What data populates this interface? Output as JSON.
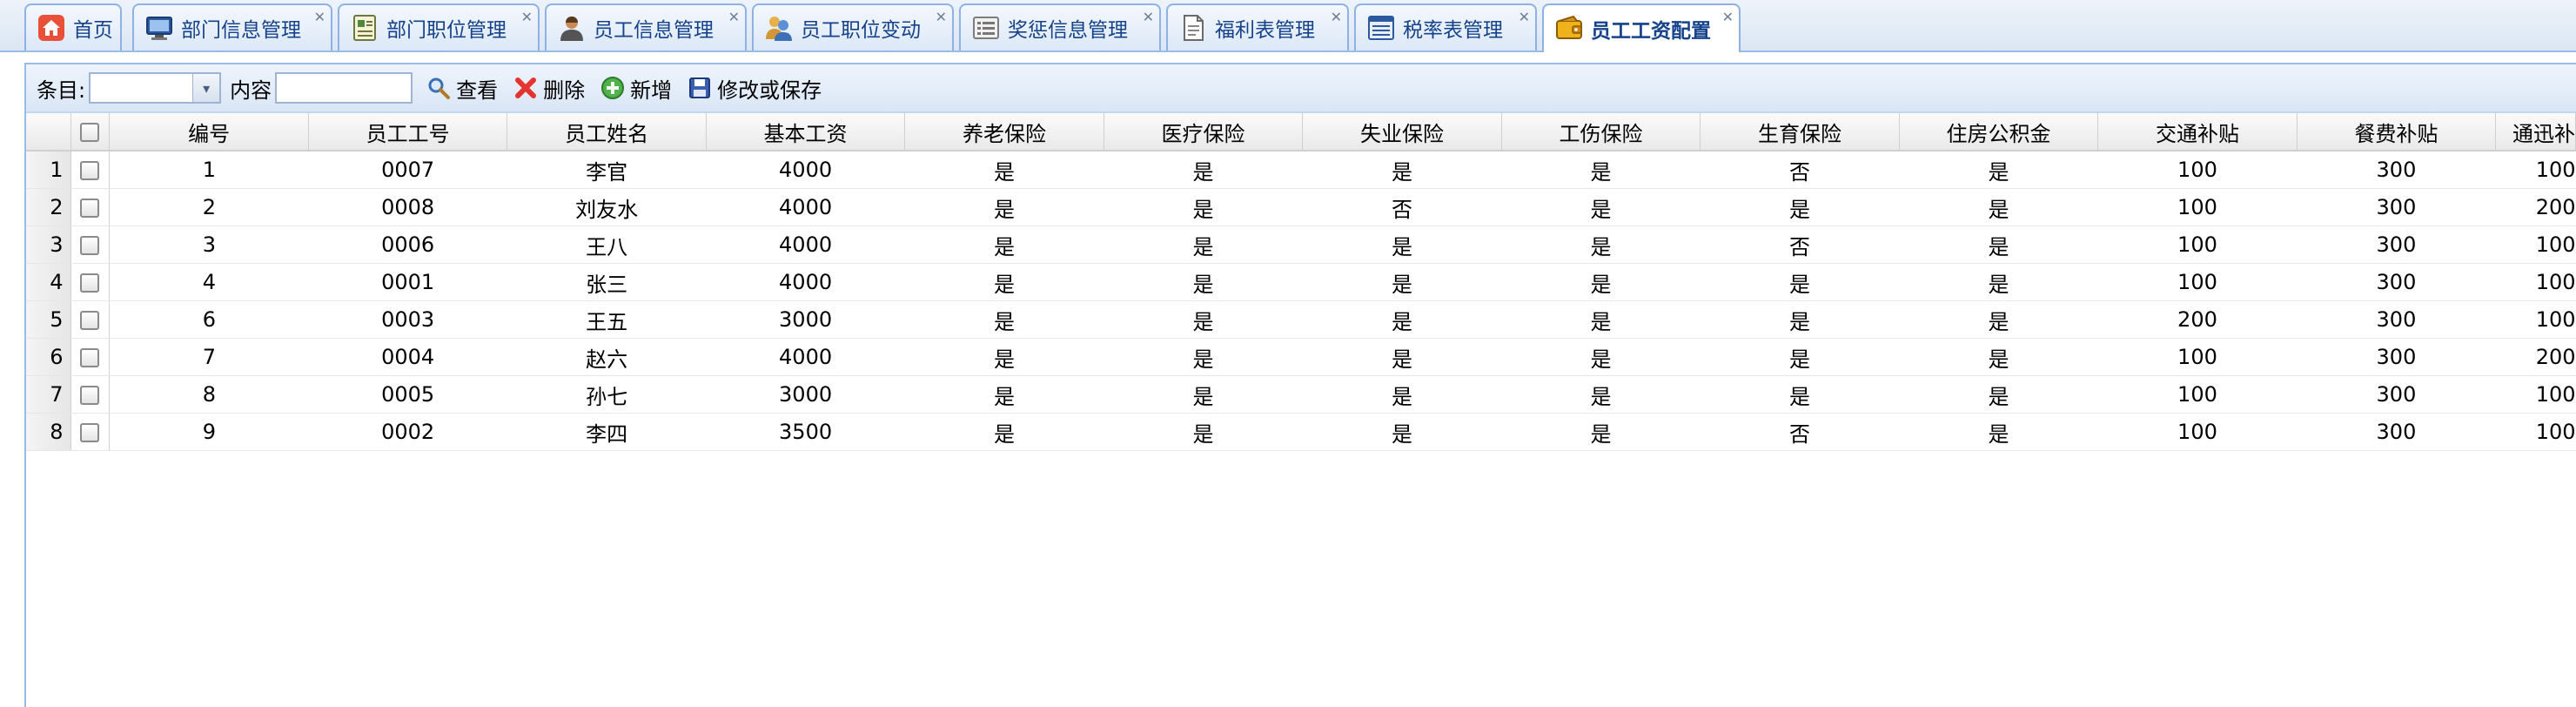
{
  "tabs": [
    {
      "label": "首页",
      "icon": "home-icon",
      "closable": false
    },
    {
      "label": "部门信息管理",
      "icon": "monitor-icon",
      "closable": true
    },
    {
      "label": "部门职位管理",
      "icon": "id-card-icon",
      "closable": true
    },
    {
      "label": "员工信息管理",
      "icon": "user-icon",
      "closable": true
    },
    {
      "label": "员工职位变动",
      "icon": "users-icon",
      "closable": true
    },
    {
      "label": "奖惩信息管理",
      "icon": "list-icon",
      "closable": true
    },
    {
      "label": "福利表管理",
      "icon": "document-icon",
      "closable": true
    },
    {
      "label": "税率表管理",
      "icon": "table-icon",
      "closable": true
    },
    {
      "label": "员工工资配置",
      "icon": "wallet-icon",
      "closable": true,
      "active": true
    }
  ],
  "toolbar": {
    "item_label": "条目:",
    "content_label": "内容",
    "view_label": "查看",
    "delete_label": "删除",
    "add_label": "新增",
    "save_label": "修改或保存"
  },
  "grid": {
    "columns": [
      "编号",
      "员工工号",
      "员工姓名",
      "基本工资",
      "养老保险",
      "医疗保险",
      "失业保险",
      "工伤保险",
      "生育保险",
      "住房公积金",
      "交通补贴",
      "餐费补贴",
      "通迅补"
    ],
    "rows": [
      {
        "rownum": "1",
        "cells": [
          "1",
          "0007",
          "李官",
          "4000",
          "是",
          "是",
          "是",
          "是",
          "否",
          "是",
          "100",
          "300",
          "100"
        ]
      },
      {
        "rownum": "2",
        "cells": [
          "2",
          "0008",
          "刘友水",
          "4000",
          "是",
          "是",
          "否",
          "是",
          "是",
          "是",
          "100",
          "300",
          "200"
        ]
      },
      {
        "rownum": "3",
        "cells": [
          "3",
          "0006",
          "王八",
          "4000",
          "是",
          "是",
          "是",
          "是",
          "否",
          "是",
          "100",
          "300",
          "100"
        ]
      },
      {
        "rownum": "4",
        "cells": [
          "4",
          "0001",
          "张三",
          "4000",
          "是",
          "是",
          "是",
          "是",
          "是",
          "是",
          "100",
          "300",
          "100"
        ]
      },
      {
        "rownum": "5",
        "cells": [
          "6",
          "0003",
          "王五",
          "3000",
          "是",
          "是",
          "是",
          "是",
          "是",
          "是",
          "200",
          "300",
          "100"
        ]
      },
      {
        "rownum": "6",
        "cells": [
          "7",
          "0004",
          "赵六",
          "4000",
          "是",
          "是",
          "是",
          "是",
          "是",
          "是",
          "100",
          "300",
          "200"
        ]
      },
      {
        "rownum": "7",
        "cells": [
          "8",
          "0005",
          "孙七",
          "3000",
          "是",
          "是",
          "是",
          "是",
          "是",
          "是",
          "100",
          "300",
          "100"
        ]
      },
      {
        "rownum": "8",
        "cells": [
          "9",
          "0002",
          "李四",
          "3500",
          "是",
          "是",
          "是",
          "是",
          "否",
          "是",
          "100",
          "300",
          "100"
        ]
      }
    ]
  }
}
